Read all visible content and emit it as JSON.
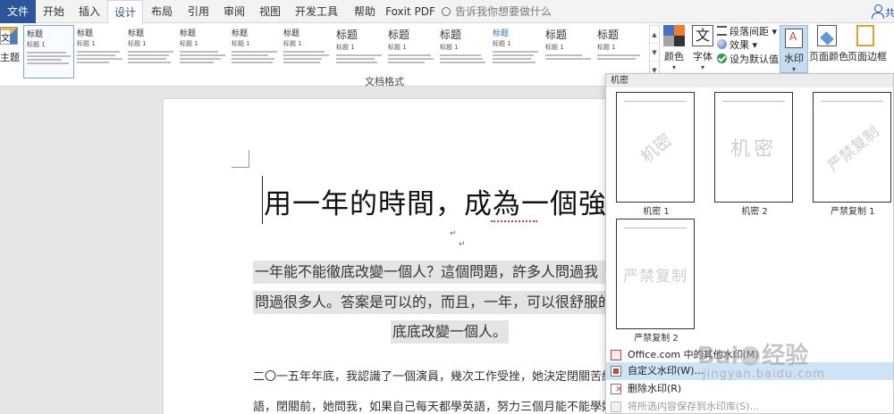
{
  "tabs": [
    {
      "label": "文件"
    },
    {
      "label": "开始"
    },
    {
      "label": "插入"
    },
    {
      "label": "设计"
    },
    {
      "label": "布局"
    },
    {
      "label": "引用"
    },
    {
      "label": "审阅"
    },
    {
      "label": "视图"
    },
    {
      "label": "开发工具"
    },
    {
      "label": "帮助"
    },
    {
      "label": "Foxit PDF"
    }
  ],
  "active_tab": "设计",
  "tell_me": {
    "text": "告诉我你想要做什么"
  },
  "share": {
    "label": "共"
  },
  "ribbon": {
    "theme": {
      "label": "主题",
      "icon_text": "文"
    },
    "style_gallery": [
      {
        "title": "标题",
        "sub": "标题 1"
      },
      {
        "title": "标题",
        "sub": "标题 1"
      },
      {
        "title": "标题",
        "sub": "标题 1"
      },
      {
        "title": "标题",
        "sub": "标题 1"
      },
      {
        "title": "标题",
        "sub": "标题 1"
      },
      {
        "title": "标题",
        "sub": "标题 1"
      },
      {
        "title": "标题",
        "sub": "标题 1"
      },
      {
        "title": "标题",
        "sub": "标题 1"
      },
      {
        "title": "标题",
        "sub": "标题 1"
      },
      {
        "title": "标题",
        "sub": "标题 1"
      },
      {
        "title": "标题",
        "sub": "标题 1"
      },
      {
        "title": "标题",
        "sub": "标题 1"
      }
    ],
    "group_label": "文档格式",
    "colors_label": "颜色",
    "fonts_label": "字体",
    "fonts_icon_text": "文",
    "paragraph_spacing": "段落间距",
    "effects": "效果",
    "set_default": "设为默认值",
    "watermark": "水印",
    "page_color": "页面颜色",
    "page_borders": "页面边框"
  },
  "document": {
    "title": "用一年的時間，成為一個強",
    "highlight_lines": [
      "一年能不能徹底改變一個人？這個問題，許多人問過我",
      "問過很多人。答案是可以的，而且，一年，可以很舒服的",
      "底底改變一個人。"
    ],
    "body_lines": [
      "二〇一五年年底，我認識了一個演員，幾次工作受挫，她決定閉關苦練",
      "語，閉關前，她問我，如果自己每天都學英語，努力三個月能不能學好"
    ],
    "para_mark": "↵"
  },
  "watermark_panel": {
    "header": "机密",
    "items": [
      {
        "label": "机密 1",
        "text": "机密"
      },
      {
        "label": "机密 2",
        "text": "机密"
      },
      {
        "label": "严禁复制 1",
        "text": "严禁复制"
      },
      {
        "label": "严禁复制 2",
        "text": "严禁复制"
      }
    ],
    "commands": {
      "office": "Office.com 中的其他水印(M)",
      "custom": "自定义水印(W)...",
      "remove": "删除水印(R)",
      "save": "将所选内容保存到水印库(S)..."
    }
  },
  "overlay": {
    "logo": "Bai",
    "logo2": "经验",
    "url": "jingyan.baidu.com"
  }
}
